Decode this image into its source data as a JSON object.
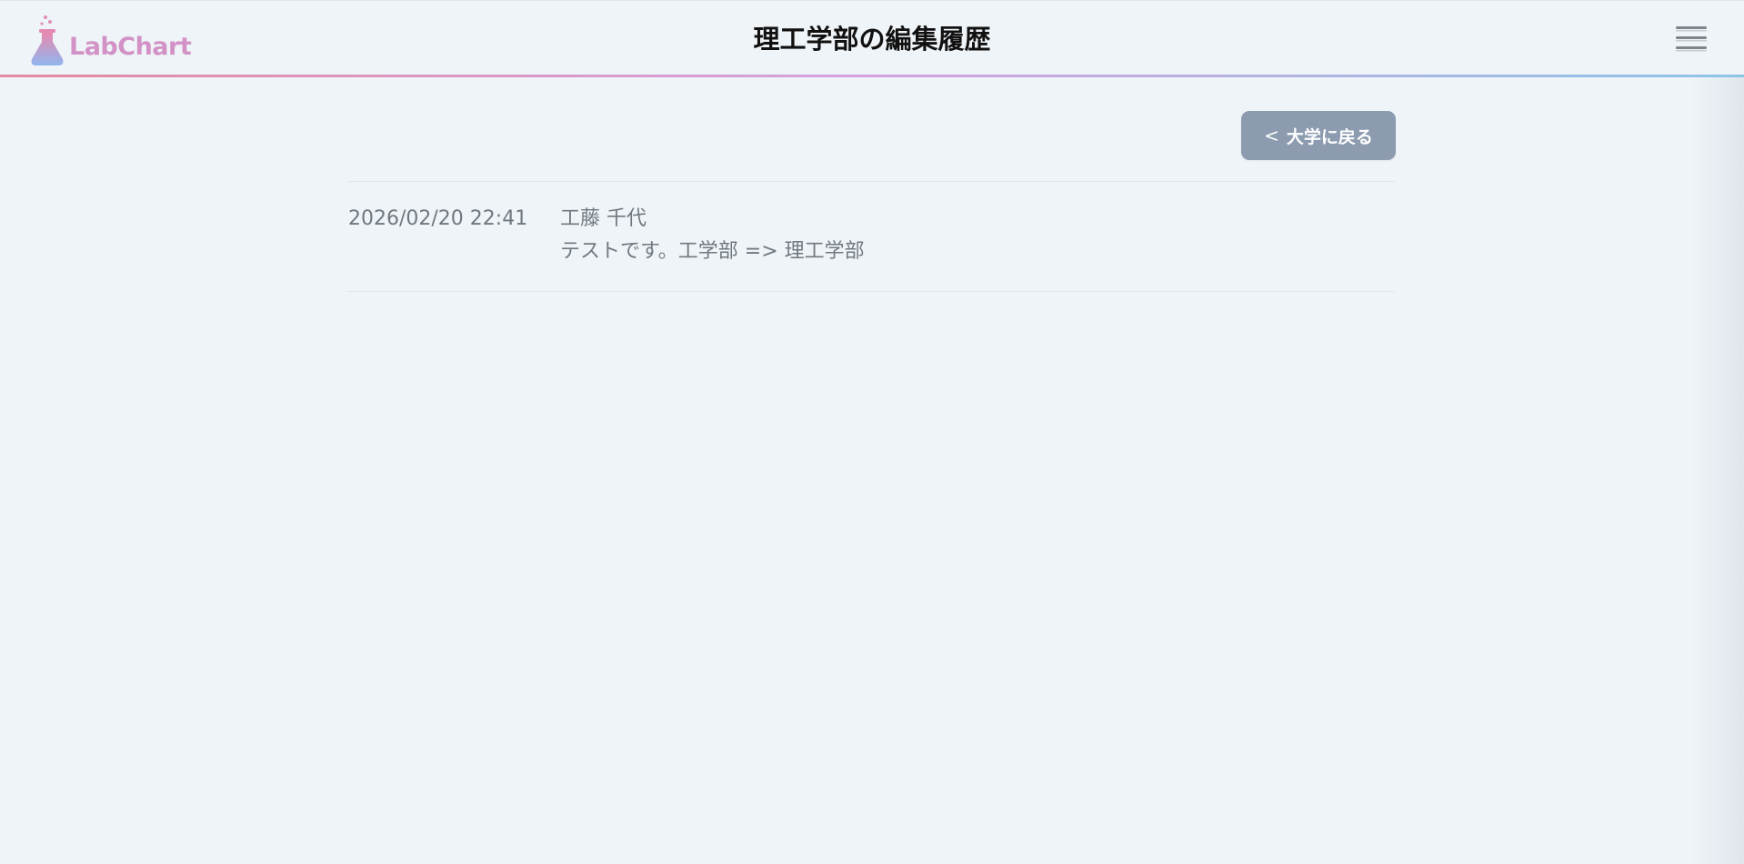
{
  "header": {
    "logo_text": "LabChart",
    "title": "理工学部の編集履歴",
    "menu_icon": "hamburger-icon"
  },
  "actions": {
    "back_chevron": "<",
    "back_label": "大学に戻る"
  },
  "history": [
    {
      "datetime": "2026/02/20 22:41",
      "user": "工藤 千代",
      "message": "テストです。工学部 => 理工学部"
    }
  ],
  "colors": {
    "background": "#eff4f8",
    "back_button": "#8c9bb0",
    "logo_gradient": [
      "#e38aa2",
      "#d5a1e0",
      "#8cc5e6"
    ],
    "entry_text": "#70787f"
  }
}
